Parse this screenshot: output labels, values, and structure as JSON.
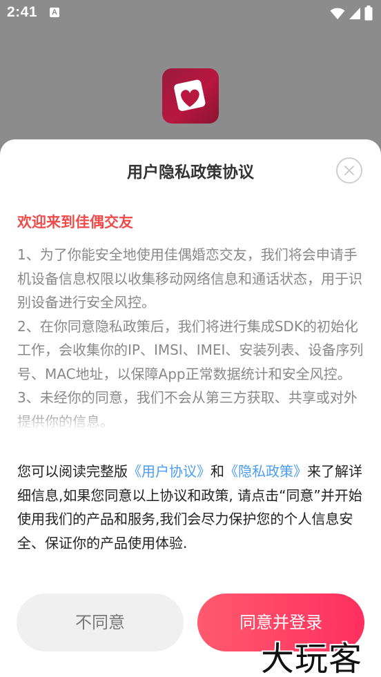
{
  "status_bar": {
    "time": "2:41",
    "notification_letter": "A"
  },
  "dialog": {
    "title": "用户隐私政策协议",
    "welcome": "欢迎来到佳偶交友",
    "policy_paragraphs": [
      "1、为了你能安全地使用佳偶婚恋交友，我们将会申请手机设备信息权限以收集移动网络信息和通话状态，用于识别设备进行安全风控。",
      "2、在你同意隐私政策后，我们将进行集成SDK的初始化工作，会收集你的IP、IMSI、IMEI、安装列表、设备序列号、MAC地址，以保障App正常数据统计和安全风控。",
      "3、未经你的同意，我们不会从第三方获取、共享或对外提供你的信息。"
    ],
    "notice_prefix": "您可以阅读完整版",
    "user_agreement_link": "《用户协议》",
    "notice_and": "和",
    "privacy_policy_link": "《隐私政策》",
    "notice_suffix": "来了解详细信息,如果您同意以上协议和政策, 请点击“同意”并开始使用我们的产品和服务,我们会尽力保护您的个人信息安全、保证你的产品使用体验.",
    "disagree_label": "不同意",
    "agree_label": "同意并登录"
  },
  "watermark": "大玩客",
  "colors": {
    "welcome": "#ef4b4b",
    "link": "#4a9df0",
    "agree_gradient_start": "#ff5a6e",
    "agree_gradient_end": "#ff2f5f",
    "logo": "#b8173f"
  },
  "icons": {
    "close": "close-icon",
    "wifi": "wifi-icon",
    "signal": "signal-icon",
    "battery": "battery-icon",
    "app_logo": "heart-card-icon"
  }
}
